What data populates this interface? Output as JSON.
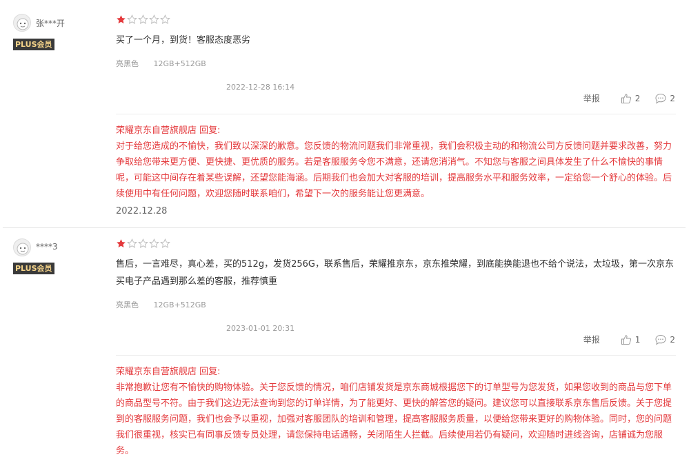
{
  "reviews": [
    {
      "username": "张***开",
      "badge": "PLUS会员",
      "rating": 1,
      "max_rating": 5,
      "content": "买了一个月，到货！客服态度恶劣",
      "color": "亮黑色",
      "spec": "12GB+512GB",
      "datetime": "2022-12-28 16:14",
      "report_label": "举报",
      "likes": "2",
      "comments": "2",
      "reply_title": "荣耀京东自营旗舰店 回复:",
      "reply_text": "对于给您造成的不愉快，我们致以深深的歉意。您反馈的物流问题我们非常重视，我们会积极主动的和物流公司方反馈问题并要求改善，努力争取给您带来更方便、更快捷、更优质的服务。若是客服服务令您不满意，还请您消消气。不知您与客服之间具体发生了什么不愉快的事情呢，可能这中间存在着某些误解，还望您能海涵。后期我们也会加大对客服的培训，提高服务水平和服务效率，一定给您一个舒心的体验。后续使用中有任何问题，欢迎您随时联系咱们，希望下一次的服务能让您更满意。",
      "reply_date": "2022.12.28"
    },
    {
      "username": "****3",
      "badge": "PLUS会员",
      "rating": 1,
      "max_rating": 5,
      "content": "售后，一言难尽，真心差，买的512g，发货256G，联系售后，荣耀推京东，京东推荣耀，到底能换能退也不给个说法，太垃圾，第一次京东买电子产品遇到那么差的客服，推荐慎重",
      "color": "亮黑色",
      "spec": "12GB+512GB",
      "datetime": "2023-01-01 20:31",
      "report_label": "举报",
      "likes": "1",
      "comments": "2",
      "reply_title": "荣耀京东自营旗舰店 回复:",
      "reply_text": "非常抱歉让您有不愉快的购物体验。关于您反馈的情况，咱们店铺发货是京东商城根据您下的订单型号为您发货，如果您收到的商品与您下单的商品型号不符。由于我们这边无法查询到您的订单详情，为了能更好、更快的解答您的疑问。建议您可以直接联系京东售后反馈。关于您提到的客服服务问题，我们也会予以重视，加强对客服团队的培训和管理，提高客服服务质量，以便给您带来更好的购物体验。同时，您的问题我们很重视，核实已有同事反馈专员处理，请您保持电话通畅，关闭陌生人拦截。后续使用若仍有疑问，欢迎随时进线咨询，店铺诚为您服务。"
    }
  ],
  "colors": {
    "star_filled": "#e4393c",
    "reply_text": "#e4393c",
    "plus_badge_bg": "#3a3a3a",
    "plus_badge_text": "#f5d48a"
  }
}
